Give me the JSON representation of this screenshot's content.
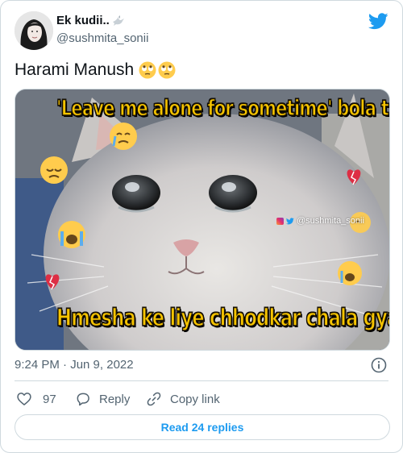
{
  "author": {
    "display_name": "Ek kudii..",
    "handle": "@sushmita_sonii"
  },
  "tweet": {
    "text": "Harami Manush"
  },
  "meme": {
    "top_caption": "'Leave me alone for sometime' bola tha.",
    "bottom_caption": "Hmesha ke liye chhodkar chala gya.",
    "watermark": "@sushmita_sonii"
  },
  "meta": {
    "timestamp": "9:24 PM · Jun 9, 2022"
  },
  "actions": {
    "like_count": "97",
    "reply_label": "Reply",
    "copy_label": "Copy link"
  },
  "replies_button": "Read 24 replies",
  "colors": {
    "brand_blue": "#1d9bf0",
    "meme_text": "#f6c400",
    "secondary_text": "#536471"
  },
  "icons": [
    "dove-icon",
    "twitter-logo-icon",
    "eye-roll-emoji-icon",
    "info-icon",
    "heart-icon",
    "reply-bubble-icon",
    "link-icon",
    "instagram-icon",
    "twitter-bird-icon"
  ]
}
